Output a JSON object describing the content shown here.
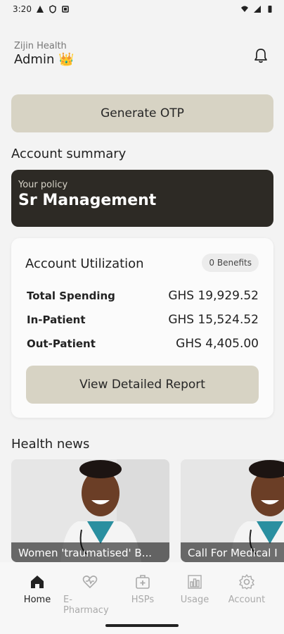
{
  "status_bar": {
    "time": "3:20"
  },
  "header": {
    "org": "Zijin Health",
    "role": "Admin",
    "crown": "👑"
  },
  "otp_button": "Generate OTP",
  "account_summary": {
    "title": "Account summary",
    "policy_label": "Your policy",
    "policy_name": "Sr Management"
  },
  "utilization": {
    "title": "Account Utilization",
    "benefits_badge": "0 Benefits",
    "rows": [
      {
        "label": "Total Spending",
        "amount": "GHS 19,929.52"
      },
      {
        "label": "In-Patient",
        "amount": "GHS 15,524.52"
      },
      {
        "label": "Out-Patient",
        "amount": "GHS 4,405.00"
      }
    ],
    "report_button": "View Detailed Report"
  },
  "news": {
    "title": "Health news",
    "items": [
      {
        "caption": "Women 'traumatised' B..."
      },
      {
        "caption": "Call For Medical I"
      }
    ]
  },
  "nav": {
    "items": [
      {
        "label": "Home",
        "icon": "home-icon",
        "active": true
      },
      {
        "label": "E-Pharmacy",
        "icon": "heart-pulse-icon",
        "active": false
      },
      {
        "label": "HSPs",
        "icon": "medical-kit-icon",
        "active": false
      },
      {
        "label": "Usage",
        "icon": "bar-chart-icon",
        "active": false
      },
      {
        "label": "Account",
        "icon": "gear-icon",
        "active": false
      }
    ]
  },
  "colors": {
    "accent_button": "#d7d3c4",
    "policy_card": "#2d2a25",
    "background": "#f3f3f3"
  }
}
